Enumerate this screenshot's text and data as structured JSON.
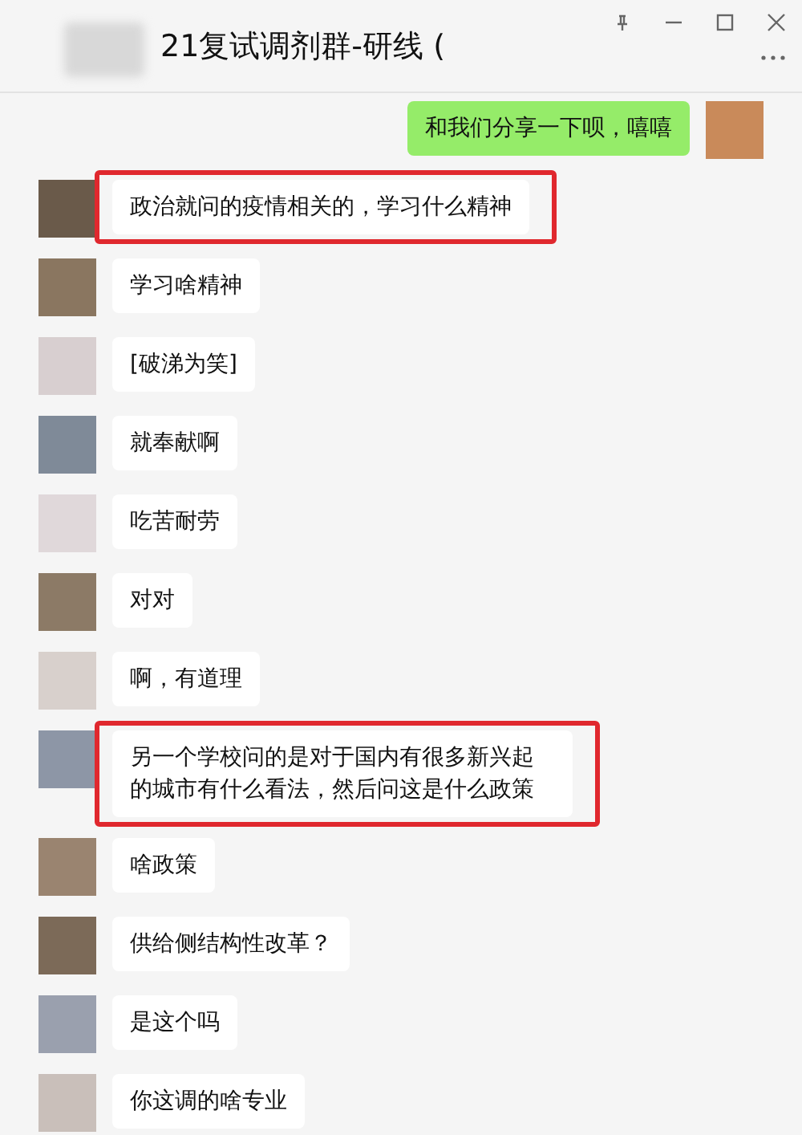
{
  "window": {
    "title": "21复试调剂群-研线 ("
  },
  "messages": [
    {
      "kind": "self",
      "text": "和我们分享一下呗，嘻嘻",
      "highlighted": false
    },
    {
      "kind": "other",
      "text": "政治就问的疫情相关的，学习什么精神",
      "highlighted": true
    },
    {
      "kind": "other",
      "text": "学习啥精神",
      "highlighted": false
    },
    {
      "kind": "other",
      "text": "[破涕为笑]",
      "highlighted": false
    },
    {
      "kind": "other",
      "text": "就奉献啊",
      "highlighted": false
    },
    {
      "kind": "other",
      "text": "吃苦耐劳",
      "highlighted": false
    },
    {
      "kind": "other",
      "text": "对对",
      "highlighted": false
    },
    {
      "kind": "other",
      "text": "啊，有道理",
      "highlighted": false
    },
    {
      "kind": "other",
      "text": "另一个学校问的是对于国内有很多新兴起的城市有什么看法，然后问这是什么政策",
      "highlighted": true
    },
    {
      "kind": "other",
      "text": "啥政策",
      "highlighted": false
    },
    {
      "kind": "other",
      "text": "供给侧结构性改革？",
      "highlighted": false
    },
    {
      "kind": "other",
      "text": "是这个吗",
      "highlighted": false
    },
    {
      "kind": "other",
      "text": "你这调的啥专业",
      "highlighted": false
    }
  ]
}
